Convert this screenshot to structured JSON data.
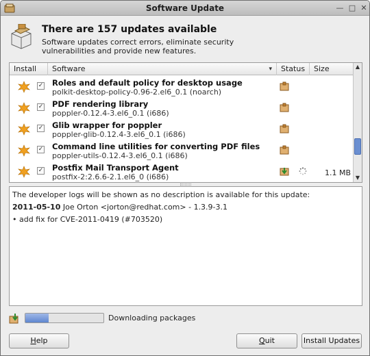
{
  "window": {
    "title": "Software Update"
  },
  "header": {
    "title": "There are 157 updates available",
    "description": "Software updates correct errors, eliminate security vulnerabilities and provide new features."
  },
  "list": {
    "columns": {
      "install": "Install",
      "software": "Software",
      "status": "Status",
      "size": "Size"
    },
    "rows": [
      {
        "name": "Roles and default policy for desktop usage",
        "package": "polkit-desktop-policy-0.96-2.el6_0.1 (noarch)",
        "checked": true,
        "size": ""
      },
      {
        "name": "PDF rendering library",
        "package": "poppler-0.12.4-3.el6_0.1 (i686)",
        "checked": true,
        "size": ""
      },
      {
        "name": "Glib wrapper for poppler",
        "package": "poppler-glib-0.12.4-3.el6_0.1 (i686)",
        "checked": true,
        "size": ""
      },
      {
        "name": "Command line utilities for converting PDF files",
        "package": "poppler-utils-0.12.4-3.el6_0.1 (i686)",
        "checked": true,
        "size": ""
      },
      {
        "name": "Postfix Mail Transport Agent",
        "package": "postfix-2:2.6.6-2.1.el6_0 (i686)",
        "checked": true,
        "size": "1.1 MB"
      }
    ]
  },
  "details": {
    "line1": "The developer logs will be shown as no description is available for this update:",
    "date": "2011-05-10",
    "author": " Joe Orton <jorton@redhat.com> - 1.3.9-3.1",
    "bullet": "• add fix for CVE-2011-0419 (#703520)"
  },
  "progress": {
    "label": "Downloading packages",
    "fraction": 0.3
  },
  "buttons": {
    "help_mnemonic": "H",
    "help_rest": "elp",
    "quit_mnemonic": "Q",
    "quit_rest": "uit",
    "install": "Install Updates"
  },
  "colors": {
    "accent": "#5f86cf",
    "update_star": "#f0a020"
  }
}
